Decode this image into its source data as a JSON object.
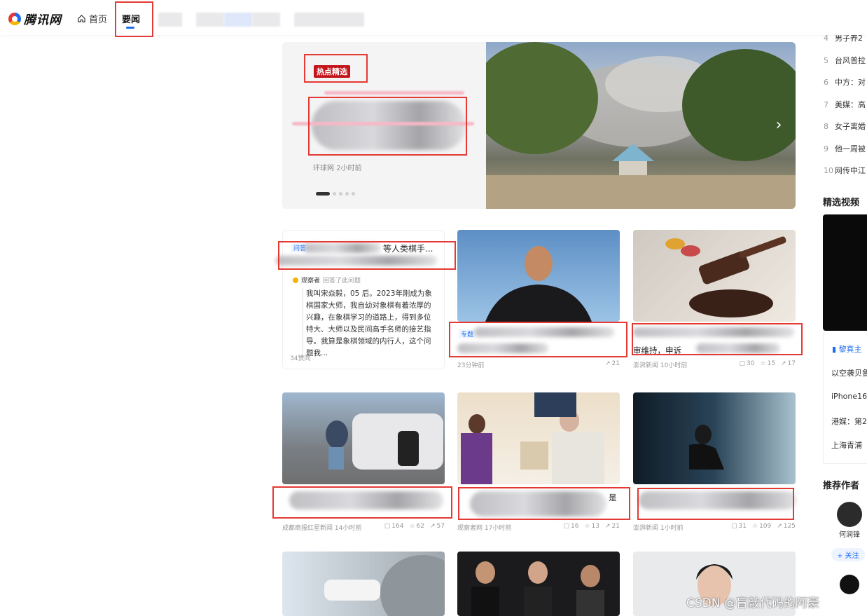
{
  "header": {
    "logo_text": "腾讯网",
    "nav_home": "首页",
    "nav_news": "要闻"
  },
  "hero": {
    "badge": "热点精选",
    "source": "环球网",
    "time": "2小时前",
    "next_icon": "›"
  },
  "qa_card": {
    "tag": "问答",
    "title_visible": "等人类棋手...",
    "user": "观察者",
    "action": "回答了此问题",
    "body": "我叫宋焱毅，05 后。2023年刚成为象棋国家大师，我自幼对象棋有着浓厚的兴趣，在象棋学习的道路上，得到多位特大、大师以及民间高手名师的接艺指导。我算是象棋领域的内行人，这个问题我...",
    "likes": "34赞同"
  },
  "cards": [
    {
      "tag": "专题",
      "meta": "23分钟前",
      "shares": "21"
    },
    {
      "title_visible": "审维持，申诉",
      "meta": "澎湃新闻 10小时前",
      "comments": "30",
      "likes": "15",
      "shares": "17"
    },
    {
      "meta": "成都商报红星新闻 14小时前",
      "comments": "164",
      "likes": "62",
      "shares": "57"
    },
    {
      "title_visible": "是",
      "meta": "观察者网 17小时前",
      "comments": "16",
      "likes": "13",
      "shares": "21"
    },
    {
      "meta": "澎湃新闻 1小时前",
      "comments": "31",
      "likes": "109",
      "shares": "125"
    }
  ],
  "sidebar": {
    "rank_items": [
      {
        "num": "4",
        "text": "男子养2"
      },
      {
        "num": "5",
        "text": "台风普拉"
      },
      {
        "num": "6",
        "text": "中方：对"
      },
      {
        "num": "7",
        "text": "美媒：高"
      },
      {
        "num": "8",
        "text": "女子离婚"
      },
      {
        "num": "9",
        "text": "他一周被"
      },
      {
        "num": "10",
        "text": "网传中江"
      }
    ],
    "video_title": "精选视频",
    "video_head": "黎真主",
    "video_items": [
      "以空袭贝鲁",
      "iPhone16",
      "港媒：第2",
      "上海青浦"
    ],
    "authors_title": "推荐作者",
    "author_name": "何润锋",
    "follow_label": "+ 关注"
  },
  "watermark": "CSDN @盲敲代码的阿豪"
}
